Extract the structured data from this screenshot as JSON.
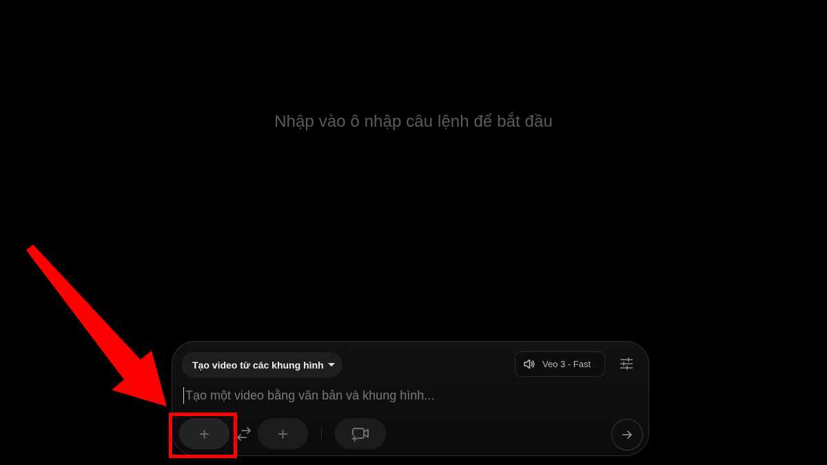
{
  "empty_state": {
    "hint": "Nhập vào ô nhập câu lệnh để bắt đầu"
  },
  "composer": {
    "mode_dropdown": {
      "label": "Tạo video từ các khung hình",
      "icon": "caret-down-icon"
    },
    "model_chip": {
      "label": "Veo 3 - Fast",
      "icon": "speaker-icon"
    },
    "settings_icon": "sliders-icon",
    "prompt": {
      "value": "",
      "placeholder": "Tạo một video bằng văn bản và khung hình..."
    },
    "start_frame": {
      "icon": "plus-icon",
      "glyph": "+"
    },
    "swap_icon": "swap-arrows-icon",
    "end_frame": {
      "icon": "plus-icon",
      "glyph": "+"
    },
    "ingredients_icon": "video-add-icon",
    "send_icon": "arrow-right-icon"
  },
  "annotation": {
    "highlight_color": "#ff0000",
    "arrow_color": "#ff0000"
  },
  "colors": {
    "background": "#000000",
    "composer_bg": "#0f0f0f",
    "button_bg": "#1c1c1c",
    "muted_text": "#5b5b5b"
  }
}
